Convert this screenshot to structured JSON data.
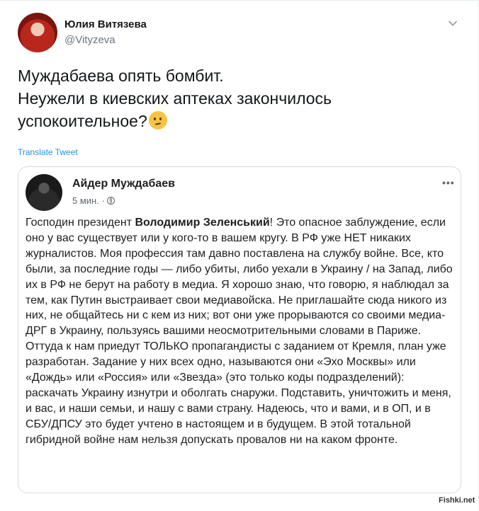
{
  "tweet": {
    "author_name": "Юлия Витязева",
    "author_handle": "@Vityzeva",
    "text_line1": "Муждабаева опять бомбит.",
    "text_line2": "Неужели в киевских аптеках закончилось",
    "text_line3": "успокоительное?",
    "emoji": "thinking-face-icon",
    "translate_label": "Translate Tweet"
  },
  "embedded_post": {
    "author_name": "Айдер Муждабаев",
    "time": "5 мин. ·",
    "more_label": "•••",
    "body_before_bold": "Господин президент ",
    "body_bold": "Володимир Зеленський",
    "body_after_bold": "! Это опасное заблуждение, если оно у вас существует или у кого-то в вашем кругу. В РФ уже НЕТ никаких журналистов. Моя профессия там давно поставлена на службу войне. Все, кто были, за последние годы — либо убиты, либо уехали в Украину / на Запад, либо их в РФ не берут на работу в медиа. Я хорошо знаю, что говорю, я наблюдал за тем, как Путин выстраивает свои медиавойска. Не приглашайте  сюда никого из них, не общайтесь ни с кем из них; вот они уже прорываются со своими медиа-ДРГ в Украину, пользуясь вашими неосмотрительными словами в Париже. Оттуда к нам приедут ТОЛЬКО пропагандисты с заданием от Кремля, план уже разработан. Задание у них всех одно, называются они «Эхо Москвы» или «Дождь» или «Россия» или «Звезда» (это только коды подразделений): раскачать Украину изнутри и оболгать снаружи. Подставить, уничтожить и меня, и вас, и наши семьи, и нашу с вами страну. Надеюсь, что и вами, и в ОП, и в СБУ/ДПСУ это будет учтено в настоящем и в будущем. В этой тотальной гибридной войне нам нельзя допускать провалов ни на каком фронте."
  },
  "watermark": "Fishki.net",
  "colors": {
    "link": "#1b95e0",
    "secondary_text": "#657786",
    "border": "#d6dade"
  }
}
